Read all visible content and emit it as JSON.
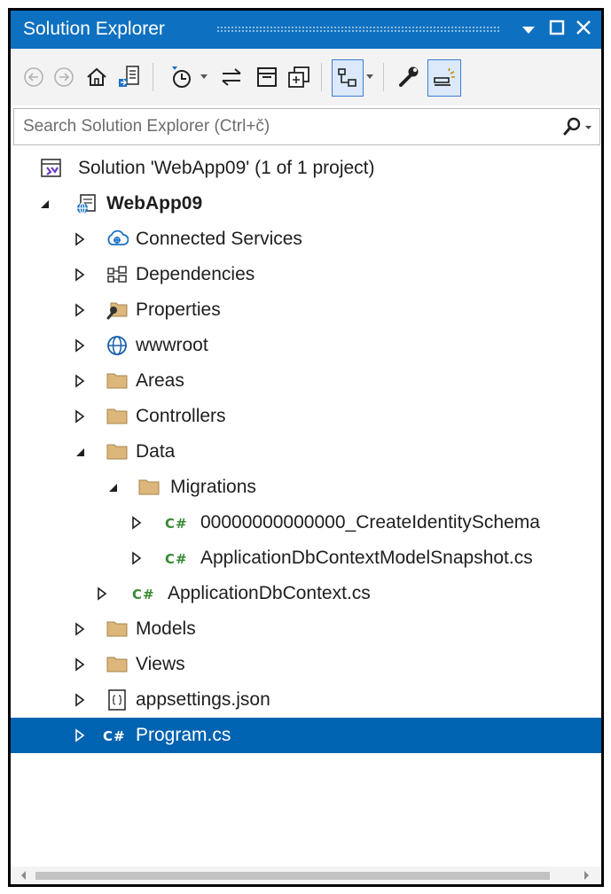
{
  "window": {
    "title": "Solution Explorer",
    "colors": {
      "titlebar": "#0e70c0",
      "selection": "#0063b1",
      "cs_icon": "#388a34",
      "folder": "#dcb67a"
    }
  },
  "title_buttons": [
    "dropdown-icon",
    "maximize-icon",
    "close-icon"
  ],
  "toolbar": {
    "items": [
      "back-icon",
      "forward-icon",
      "home-icon",
      "switch-views-icon",
      "pending-changes-filter-icon",
      "sync-active-document-icon",
      "collapse-all-icon",
      "show-all-files-icon",
      "view-class-diagram-icon",
      "properties-icon",
      "preview-selected-items-icon"
    ]
  },
  "search": {
    "placeholder": "Search Solution Explorer (Ctrl+č)",
    "value": ""
  },
  "tree": {
    "solution": "Solution 'WebApp09' (1 of 1 project)",
    "project": "WebApp09",
    "connected_services": "Connected Services",
    "dependencies": "Dependencies",
    "properties": "Properties",
    "wwwroot": "wwwroot",
    "areas": "Areas",
    "controllers": "Controllers",
    "data": "Data",
    "migrations": "Migrations",
    "migration_file": "00000000000000_CreateIdentitySchema",
    "snapshot_file": "ApplicationDbContextModelSnapshot.cs",
    "db_context": "ApplicationDbContext.cs",
    "models": "Models",
    "views": "Views",
    "appsettings": "appsettings.json",
    "program": "Program.cs"
  },
  "cs_badge": "C#"
}
